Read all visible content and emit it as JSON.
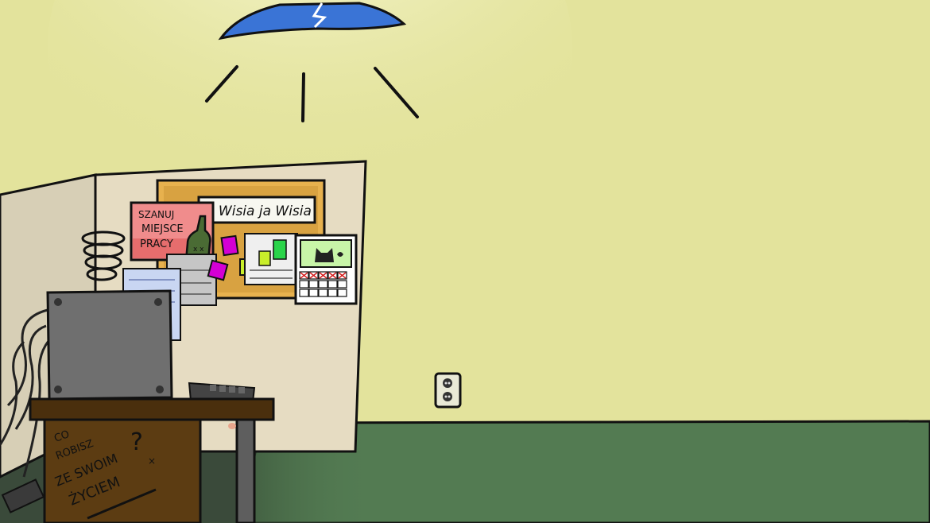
{
  "scene": {
    "poster_pink": [
      "SZANUJ",
      "MIEJSCE",
      "PRACY"
    ],
    "corkboard_banner": "Ja Wisia ja Wisia",
    "desk_graffiti": [
      "CO",
      "ROBISZ",
      "ZE SWOIM",
      "ŻYCIEM",
      "?",
      "×"
    ],
    "colors": {
      "wall": "#e3e39c",
      "floor": "#537b52",
      "lamp_shade": "#3a74d6",
      "cubicle": "#e6dcc2",
      "corkboard": "#e7b14e",
      "poster": "#f08c8c",
      "desk": "#5c3c12",
      "pc_case": "#6f6f6f"
    },
    "icons": [
      "ceiling-lamp-icon",
      "wall-socket-icon",
      "bottle-icon",
      "cat-face-icon",
      "calendar-icon",
      "coil-spring-icon"
    ]
  }
}
